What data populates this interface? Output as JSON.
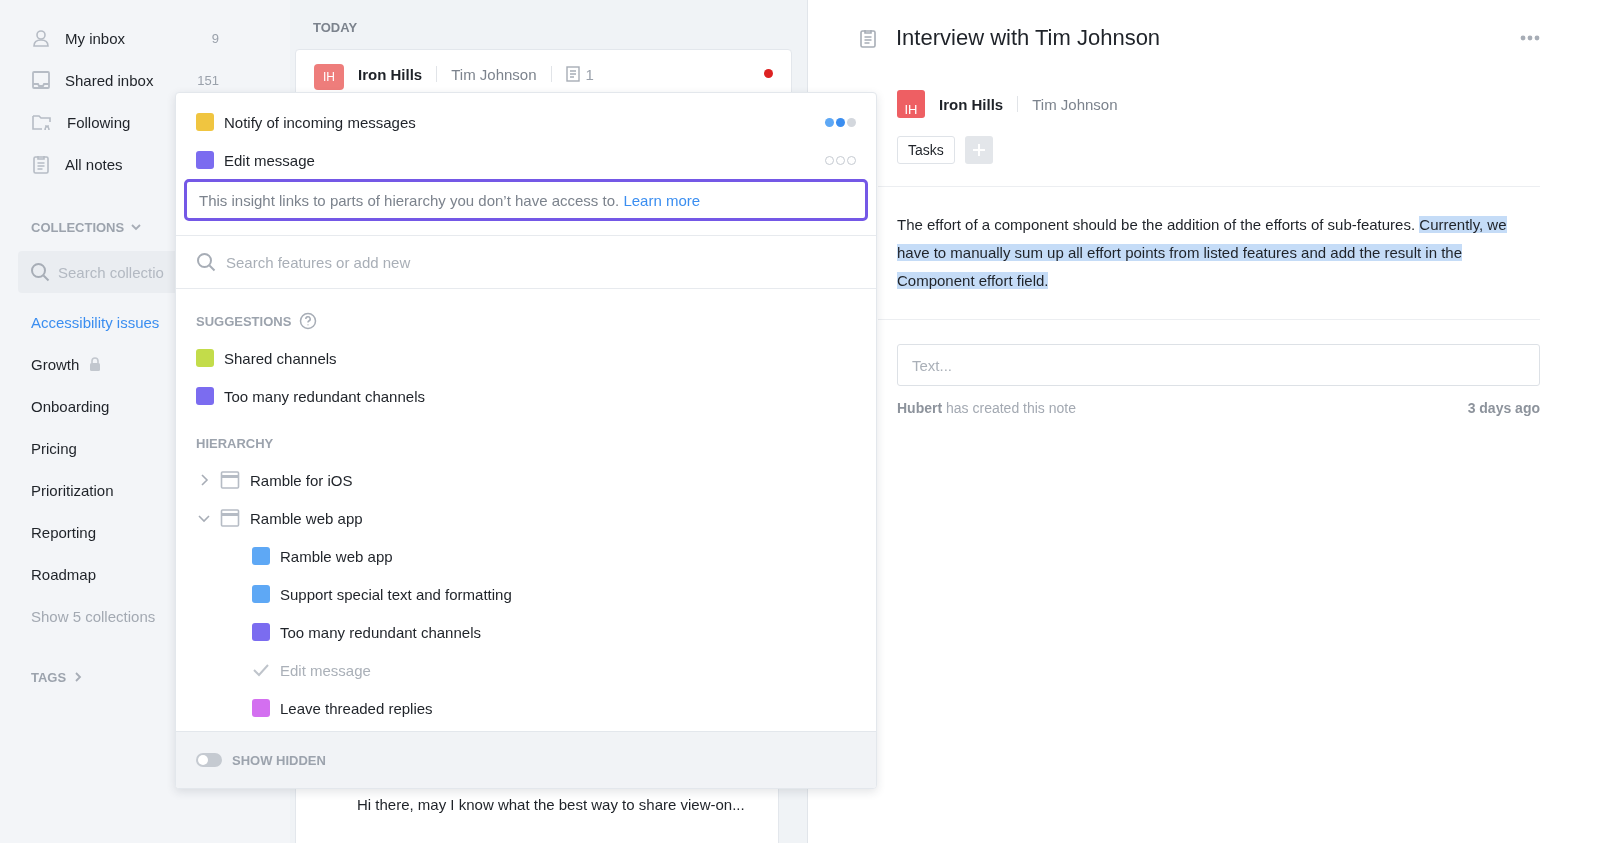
{
  "sidebar": {
    "nav": [
      {
        "label": "My inbox",
        "count": "9"
      },
      {
        "label": "Shared inbox",
        "count": "151"
      },
      {
        "label": "Following"
      },
      {
        "label": "All notes"
      }
    ],
    "collections_header": "COLLECTIONS",
    "collections_expanded": true,
    "search": {
      "placeholder": "Search collectio"
    },
    "collections": [
      {
        "label": "Accessibility issues",
        "selected": true,
        "locked": false
      },
      {
        "label": "Growth",
        "selected": false,
        "locked": true
      },
      {
        "label": "Onboarding",
        "selected": false,
        "locked": false
      },
      {
        "label": "Pricing",
        "selected": false,
        "locked": false
      },
      {
        "label": "Prioritization",
        "selected": false,
        "locked": false
      },
      {
        "label": "Reporting",
        "selected": false,
        "locked": false
      },
      {
        "label": "Roadmap",
        "selected": false,
        "locked": false
      }
    ],
    "show_more": "Show 5 collections",
    "tags_header": "TAGS"
  },
  "note_list": {
    "group": "TODAY",
    "card": {
      "avatar": "IH",
      "company": "Iron Hills",
      "person": "Tim Johnson",
      "comments": "1",
      "unread": true
    },
    "second_card": {
      "preview": "Hi there, may I know what the best way to share view-on..."
    }
  },
  "popup": {
    "linked": [
      {
        "label": "Notify of incoming messages",
        "color": "#f0c540",
        "stars": 2
      },
      {
        "label": "Edit message",
        "color": "#7b6cf0",
        "stars": 0
      }
    ],
    "notice": {
      "text": "This insight links to parts of hierarchy you don’t have access to.",
      "link": "Learn more"
    },
    "search": {
      "placeholder": "Search features or add new"
    },
    "suggestions_header": "SUGGESTIONS",
    "suggestions": [
      {
        "label": "Shared channels",
        "color": "#c3dc4a"
      },
      {
        "label": "Too many redundant channels",
        "color": "#7b6cf0"
      }
    ],
    "hierarchy_header": "HIERARCHY",
    "hierarchy": [
      {
        "label": "Ramble for iOS",
        "expanded": false
      },
      {
        "label": "Ramble web app",
        "expanded": true,
        "children": [
          {
            "label": "Ramble web app",
            "kind": "feature",
            "color": "#5ea8f5"
          },
          {
            "label": "Support special text and formatting",
            "kind": "feature",
            "color": "#5ea8f5"
          },
          {
            "label": "Too many redundant channels",
            "kind": "feature",
            "color": "#7b6cf0"
          },
          {
            "label": "Edit message",
            "kind": "linked"
          },
          {
            "label": "Leave threaded replies",
            "kind": "feature",
            "color": "#d36ff0"
          }
        ]
      }
    ],
    "show_hidden": {
      "label": "SHOW HIDDEN",
      "on": false
    }
  },
  "note": {
    "title": "Interview with Tim Johnson",
    "avatar": "IH",
    "company": "Iron Hills",
    "person": "Tim Johnson",
    "tags": [
      "Tasks"
    ],
    "body": {
      "text": "The effort of a component should be the addition of the efforts of sub-features. ",
      "selected_text": "Currently, we have to manually sum up all effort points from listed features and add the result in the Component effort field."
    },
    "comment": {
      "placeholder": "Text..."
    },
    "activity": "**Hubert** has created this note",
    "time": "3 days ago"
  }
}
